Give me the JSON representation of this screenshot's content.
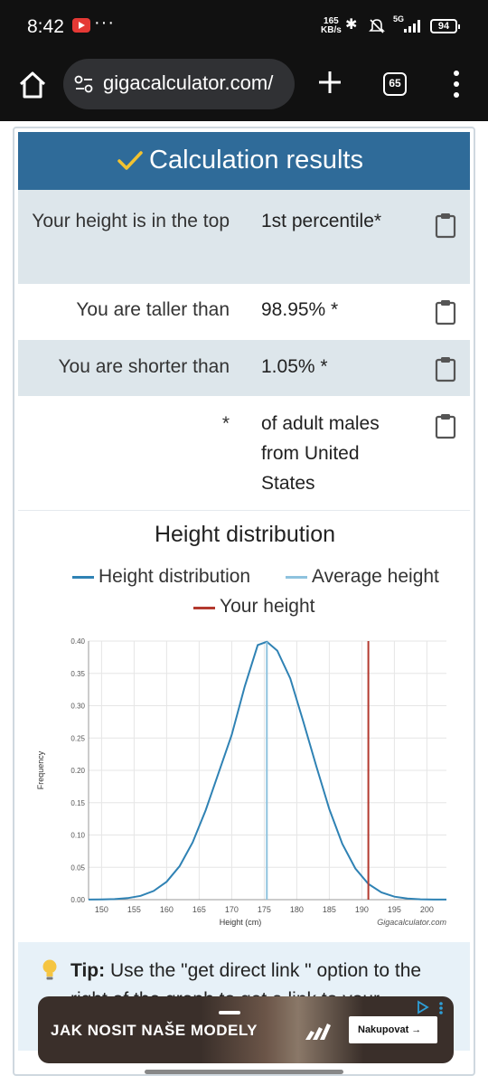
{
  "status": {
    "time": "8:42",
    "speed_top": "165",
    "speed_unit": "KB/s",
    "battery": "94",
    "net": "5G"
  },
  "browser": {
    "url": "gigacalculator.com/",
    "tab_count": "65"
  },
  "results": {
    "header": "Calculation results",
    "rows": [
      {
        "label": "Your height is in the top",
        "value": "1st percentile*"
      },
      {
        "label": "You are taller than",
        "value": "98.95% *"
      },
      {
        "label": "You are shorter than",
        "value": "1.05% *"
      },
      {
        "label": "*",
        "value": "of adult males from United States"
      }
    ]
  },
  "chart_title": "Height distribution",
  "legend": [
    {
      "label": "Height distribution",
      "color": "#2f82b4"
    },
    {
      "label": "Average height",
      "color": "#8ec2de"
    },
    {
      "label": "Your height",
      "color": "#b3392e"
    }
  ],
  "chart_data": {
    "type": "line",
    "title": "Height distribution",
    "xlabel": "Height (cm)",
    "ylabel": "Frequency",
    "xlim": [
      148,
      203
    ],
    "ylim": [
      0,
      0.4
    ],
    "x_ticks": [
      150,
      155,
      160,
      165,
      170,
      175,
      180,
      185,
      190,
      195,
      200
    ],
    "y_ticks": [
      "0.00",
      "0.05",
      "0.10",
      "0.15",
      "0.20",
      "0.25",
      "0.30",
      "0.35",
      "0.40"
    ],
    "series": [
      {
        "name": "Height distribution",
        "x": [
          148,
          150,
          152,
          154,
          156,
          158,
          160,
          162,
          164,
          166,
          168,
          170,
          172,
          174,
          175.4,
          177,
          179,
          181,
          183,
          185,
          187,
          189,
          191,
          193,
          195,
          197,
          199,
          201,
          203
        ],
        "y": [
          0.0001,
          0.0003,
          0.0009,
          0.0024,
          0.0059,
          0.0134,
          0.0277,
          0.0519,
          0.0887,
          0.1383,
          0.1966,
          0.255,
          0.3297,
          0.3938,
          0.3989,
          0.3852,
          0.3423,
          0.2755,
          0.2064,
          0.14,
          0.0862,
          0.0482,
          0.0244,
          0.0112,
          0.0046,
          0.0018,
          0.0006,
          0.0002,
          0.0001
        ]
      }
    ],
    "average_height": 175.4,
    "your_height": 191,
    "watermark": "Gigacalculator.com",
    "grid": true,
    "legend_position": "top"
  },
  "tip": {
    "bold": "Tip:",
    "text": "Use the \"get direct link \" option to the right of the graph to get a link to your calculation."
  },
  "ad": {
    "headline": "JAK NOSIT NAŠE MODELY",
    "cta": "Nakupovat →"
  }
}
